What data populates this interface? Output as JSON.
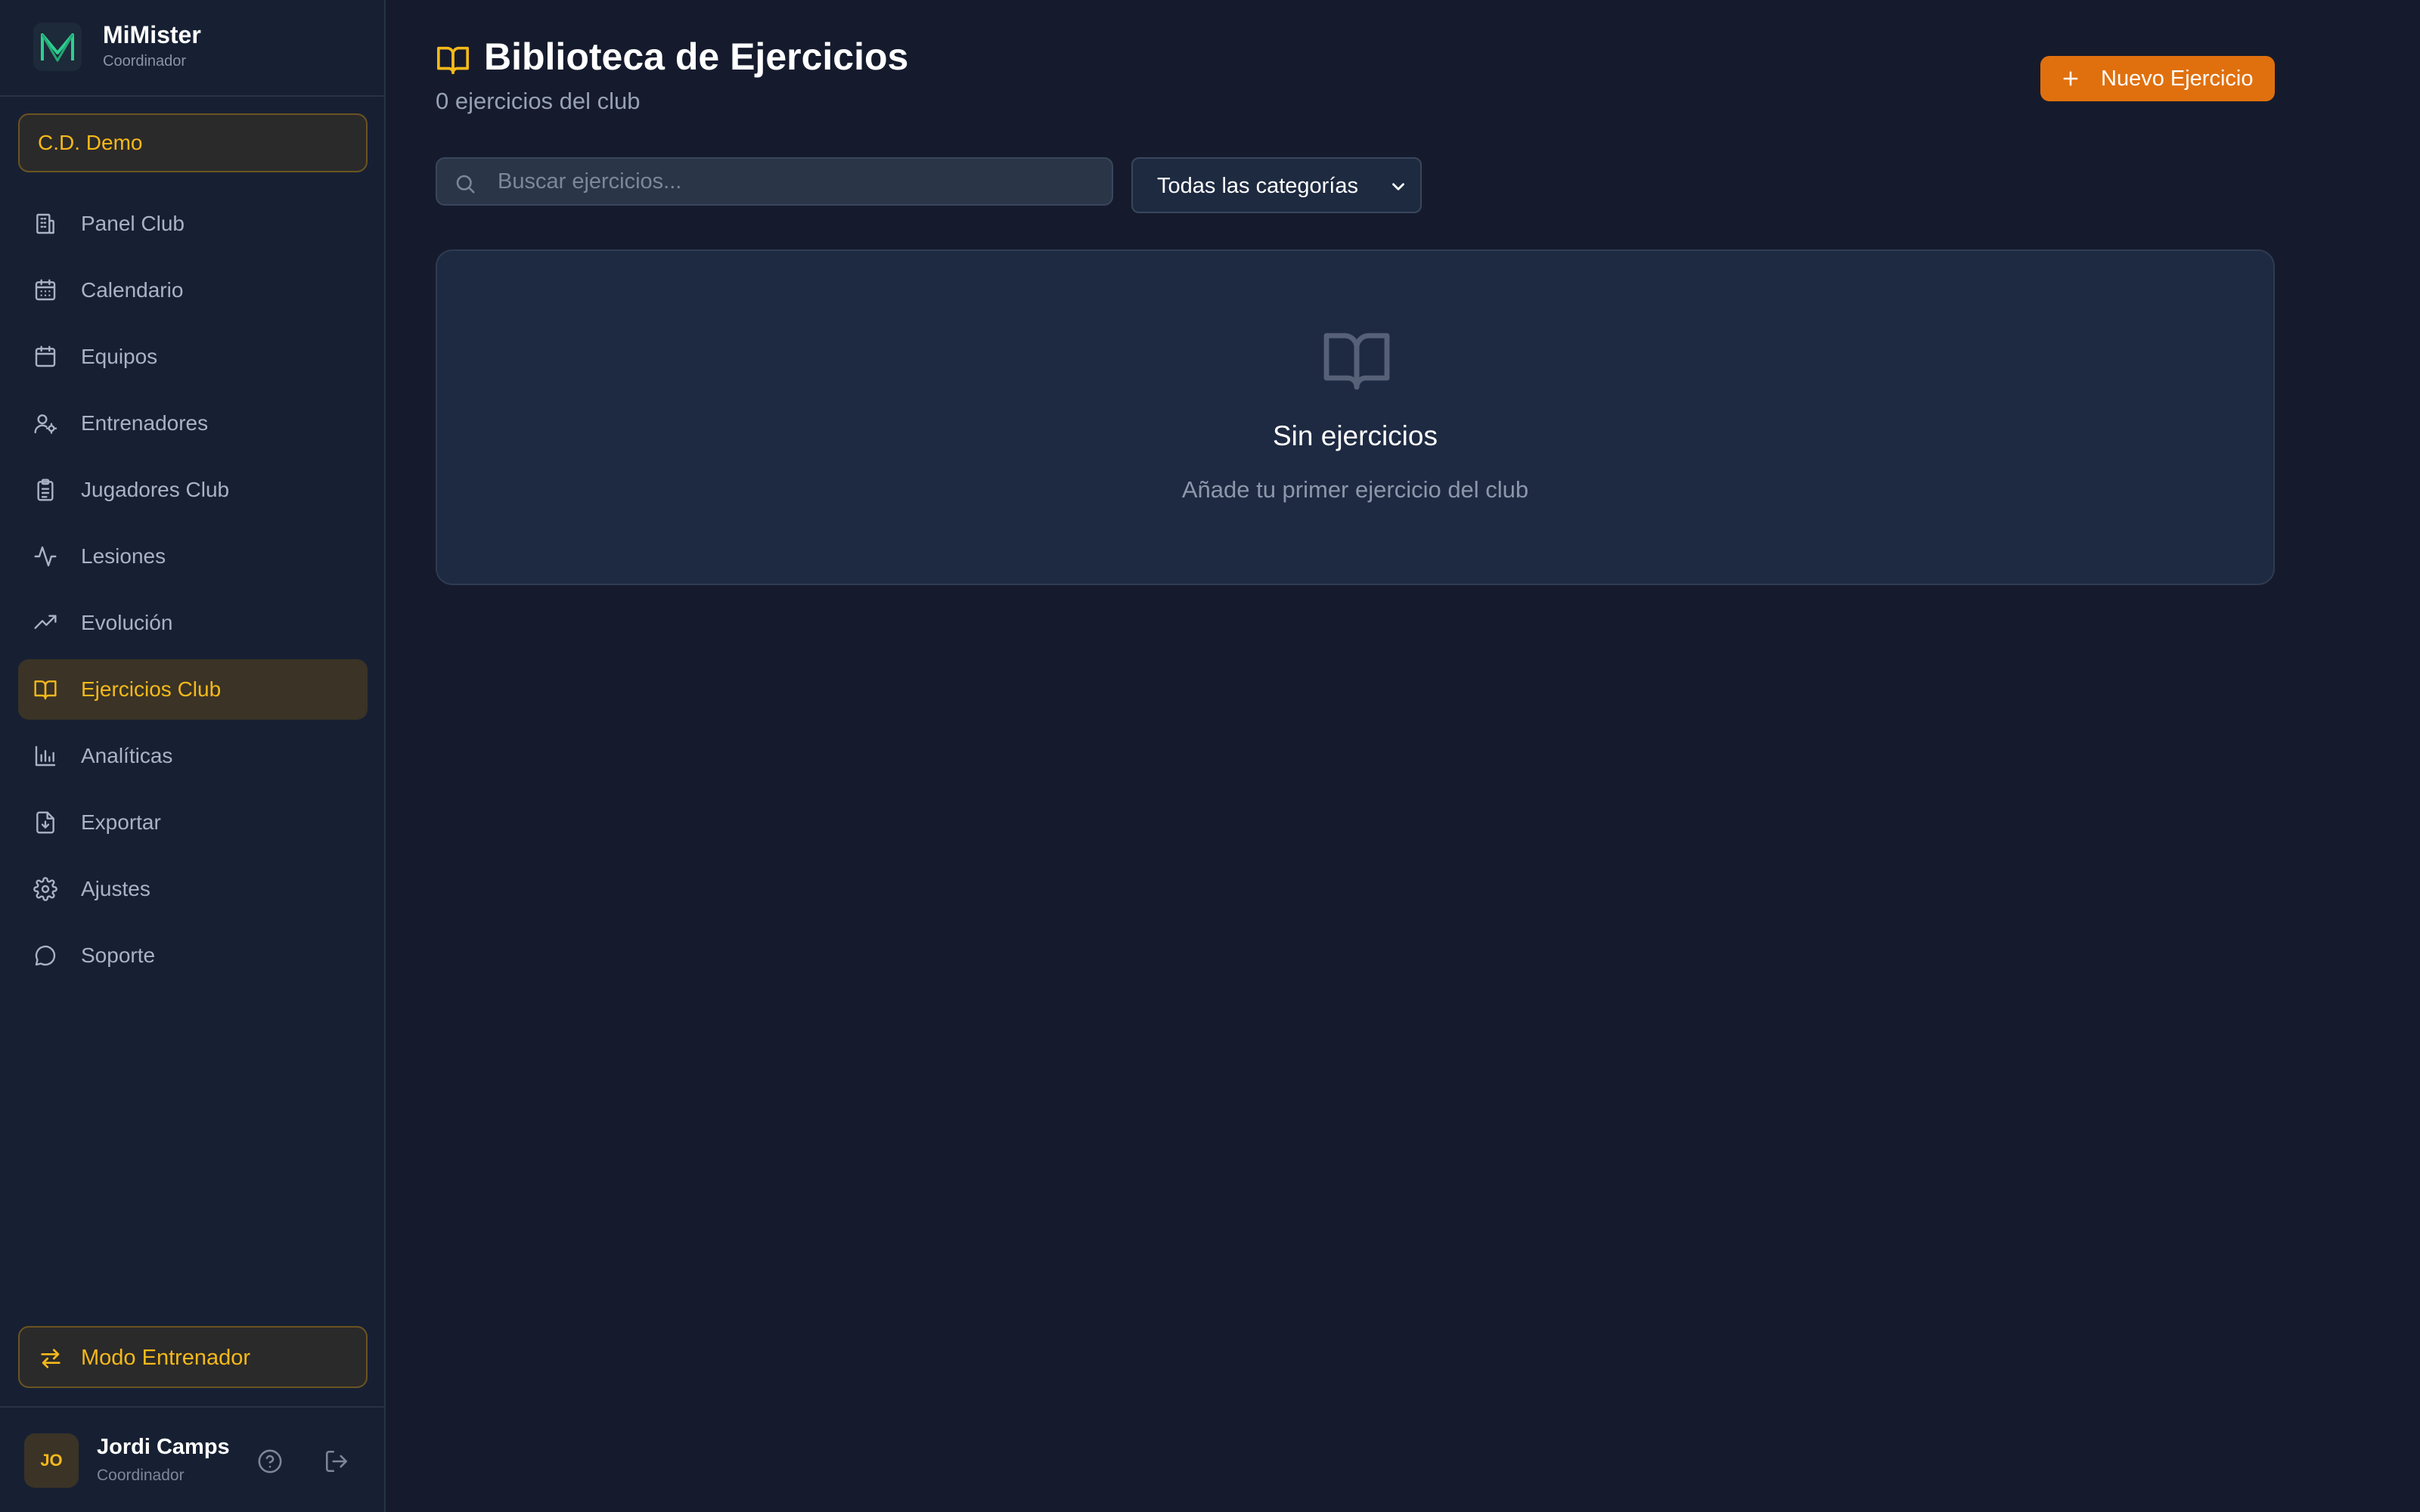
{
  "brand": {
    "name": "MiMister",
    "role": "Coordinador"
  },
  "club": {
    "name": "C.D. Demo"
  },
  "sidebar": {
    "items": [
      {
        "label": "Panel Club",
        "icon": "building-icon"
      },
      {
        "label": "Calendario",
        "icon": "calendar-grid-icon"
      },
      {
        "label": "Equipos",
        "icon": "calendar-icon"
      },
      {
        "label": "Entrenadores",
        "icon": "user-cog-icon"
      },
      {
        "label": "Jugadores Club",
        "icon": "clipboard-icon"
      },
      {
        "label": "Lesiones",
        "icon": "activity-icon"
      },
      {
        "label": "Evolución",
        "icon": "trending-up-icon"
      },
      {
        "label": "Ejercicios Club",
        "icon": "book-open-icon",
        "active": true
      },
      {
        "label": "Analíticas",
        "icon": "bar-chart-icon"
      },
      {
        "label": "Exportar",
        "icon": "file-download-icon"
      },
      {
        "label": "Ajustes",
        "icon": "gear-icon"
      },
      {
        "label": "Soporte",
        "icon": "chat-bubble-icon"
      }
    ]
  },
  "mode_button": {
    "label": "Modo Entrenador",
    "icon": "swap-arrows-icon"
  },
  "user": {
    "initials": "JO",
    "name": "Jordi Camps",
    "role": "Coordinador"
  },
  "header": {
    "title": "Biblioteca de Ejercicios",
    "subtitle": "0 ejercicios del club",
    "new_button_label": "Nuevo Ejercicio"
  },
  "filters": {
    "search_placeholder": "Buscar ejercicios...",
    "category_selected": "Todas las categorías"
  },
  "empty_state": {
    "title": "Sin ejercicios",
    "description": "Añade tu primer ejercicio del club"
  },
  "colors": {
    "background": "#151b2d",
    "sidebar": "#172033",
    "accent": "#f5b91a",
    "primary_button": "#e0700e",
    "brand_logo": "#2ecf8f"
  }
}
